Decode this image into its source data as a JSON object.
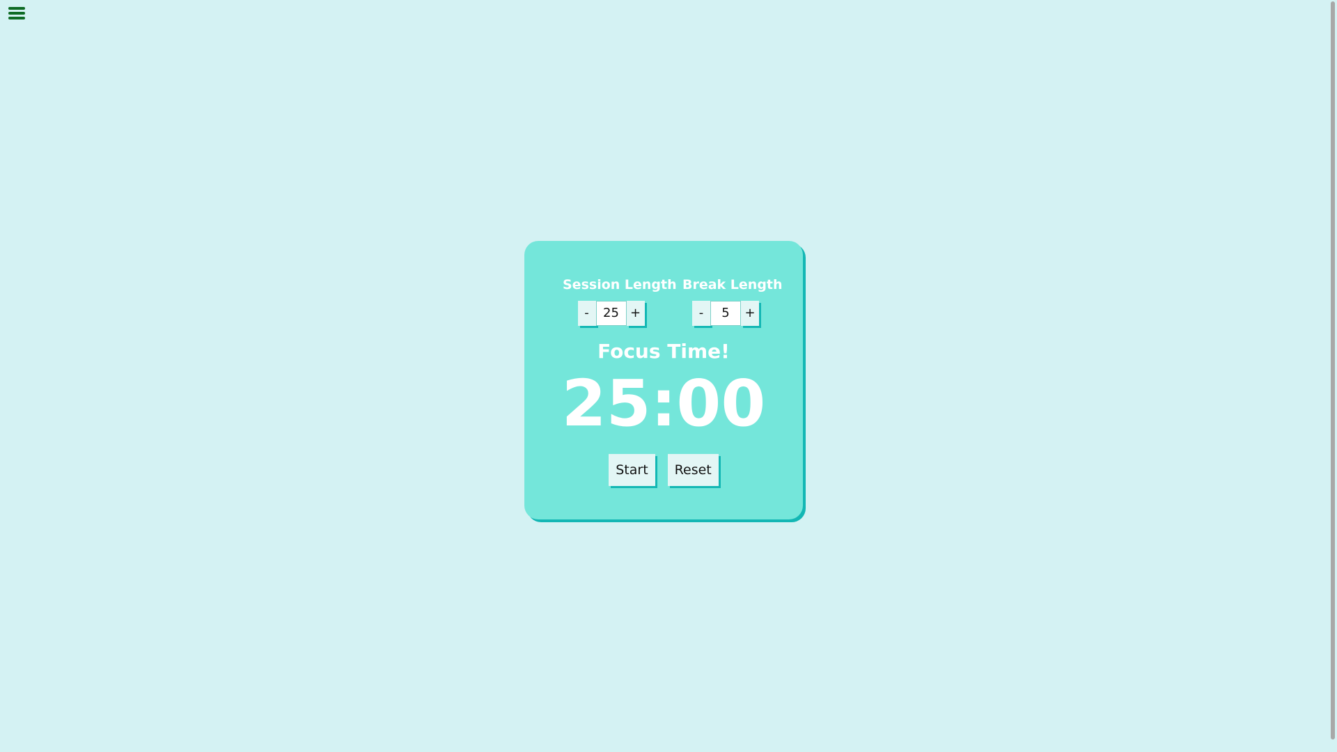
{
  "menu": {
    "icon": "hamburger-menu-icon"
  },
  "session": {
    "label": "Session Length",
    "decrement": "-",
    "value": "25",
    "increment": "+"
  },
  "break": {
    "label": "Break Length",
    "decrement": "-",
    "value": "5",
    "increment": "+"
  },
  "status": "Focus Time!",
  "timer": "25:00",
  "controls": {
    "start": "Start",
    "reset": "Reset"
  },
  "colors": {
    "background": "#d4f2f3",
    "card": "#74e6da",
    "card_shadow": "#13b7b4",
    "menu_icon": "#0e6b24",
    "text_light": "#ffffff"
  }
}
